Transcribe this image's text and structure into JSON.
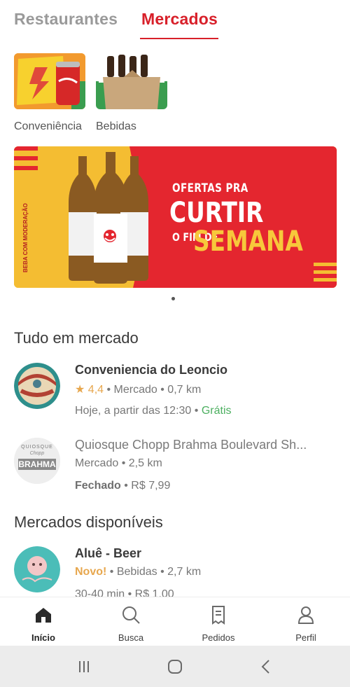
{
  "tabs": {
    "restaurantes": "Restaurantes",
    "mercados": "Mercados"
  },
  "categories": [
    {
      "label": "Conveniência",
      "icon": "snacks-soda-icon"
    },
    {
      "label": "Bebidas",
      "icon": "beer-pack-icon"
    }
  ],
  "banner": {
    "line1": "OFERTAS PRA",
    "line2": "CURTIR",
    "line3": "O FIM DE",
    "line4": "SEMANA",
    "side_text": "BEBA COM MODERAÇÃO"
  },
  "sections": {
    "all": "Tudo em mercado",
    "available": "Mercados disponíveis"
  },
  "stores": [
    {
      "name": "Conveniencia do Leoncio",
      "rating": "4,4",
      "category": "Mercado",
      "distance": "0,7 km",
      "schedule": "Hoje, a partir das 12:30",
      "fee": "Grátis"
    },
    {
      "name": "Quiosque Chopp Brahma Boulevard Sh...",
      "category": "Mercado",
      "distance": "2,5 km",
      "status": "Fechado",
      "fee": "R$ 7,99",
      "logo_top": "QUIOSQUE",
      "logo_mid": "Chopp",
      "logo_bottom": "BRAHMA"
    },
    {
      "name": "Aluê - Beer",
      "badge": "Novo!",
      "category": "Bebidas",
      "distance": "2,7 km",
      "eta": "30-40 min",
      "fee": "R$ 1,00"
    }
  ],
  "sep": " • ",
  "nav": {
    "inicio": "Início",
    "busca": "Busca",
    "pedidos": "Pedidos",
    "perfil": "Perfil"
  },
  "colors": {
    "brand_red": "#d8202a",
    "banner_yellow": "#f4bd32",
    "rating": "#e7a74e",
    "free": "#4caf60"
  }
}
